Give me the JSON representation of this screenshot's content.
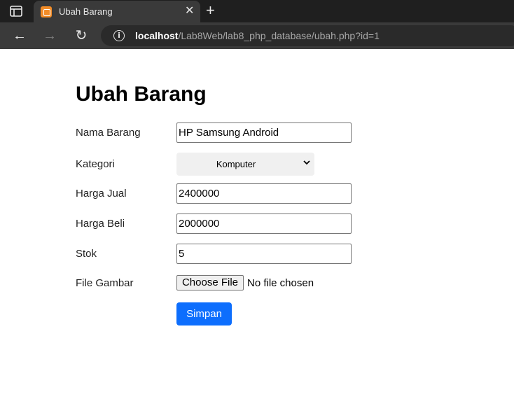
{
  "browser": {
    "tab": {
      "title": "Ubah Barang",
      "favicon": "xampp-icon",
      "close_glyph": "✕"
    },
    "new_tab_glyph": "+",
    "nav": {
      "back_glyph": "←",
      "forward_glyph": "→",
      "reload_glyph": "↻"
    },
    "url": {
      "host": "localhost",
      "path": "/Lab8Web/lab8_php_database/ubah.php?id=1"
    },
    "colors": {
      "tabbar": "#1f1f1f",
      "toolbar": "#3a3a3a"
    }
  },
  "page": {
    "title": "Ubah Barang",
    "form": {
      "nama_barang": {
        "label": "Nama Barang",
        "value": "HP Samsung Android"
      },
      "kategori": {
        "label": "Kategori",
        "selected": "Komputer"
      },
      "harga_jual": {
        "label": "Harga Jual",
        "value": "2400000"
      },
      "harga_beli": {
        "label": "Harga Beli",
        "value": "2000000"
      },
      "stok": {
        "label": "Stok",
        "value": "5"
      },
      "file_gambar": {
        "label": "File Gambar",
        "button": "Choose File",
        "status": "No file chosen"
      },
      "submit_label": "Simpan"
    },
    "colors": {
      "primary_button": "#0d6efd",
      "favicon": "#f28c28"
    }
  }
}
